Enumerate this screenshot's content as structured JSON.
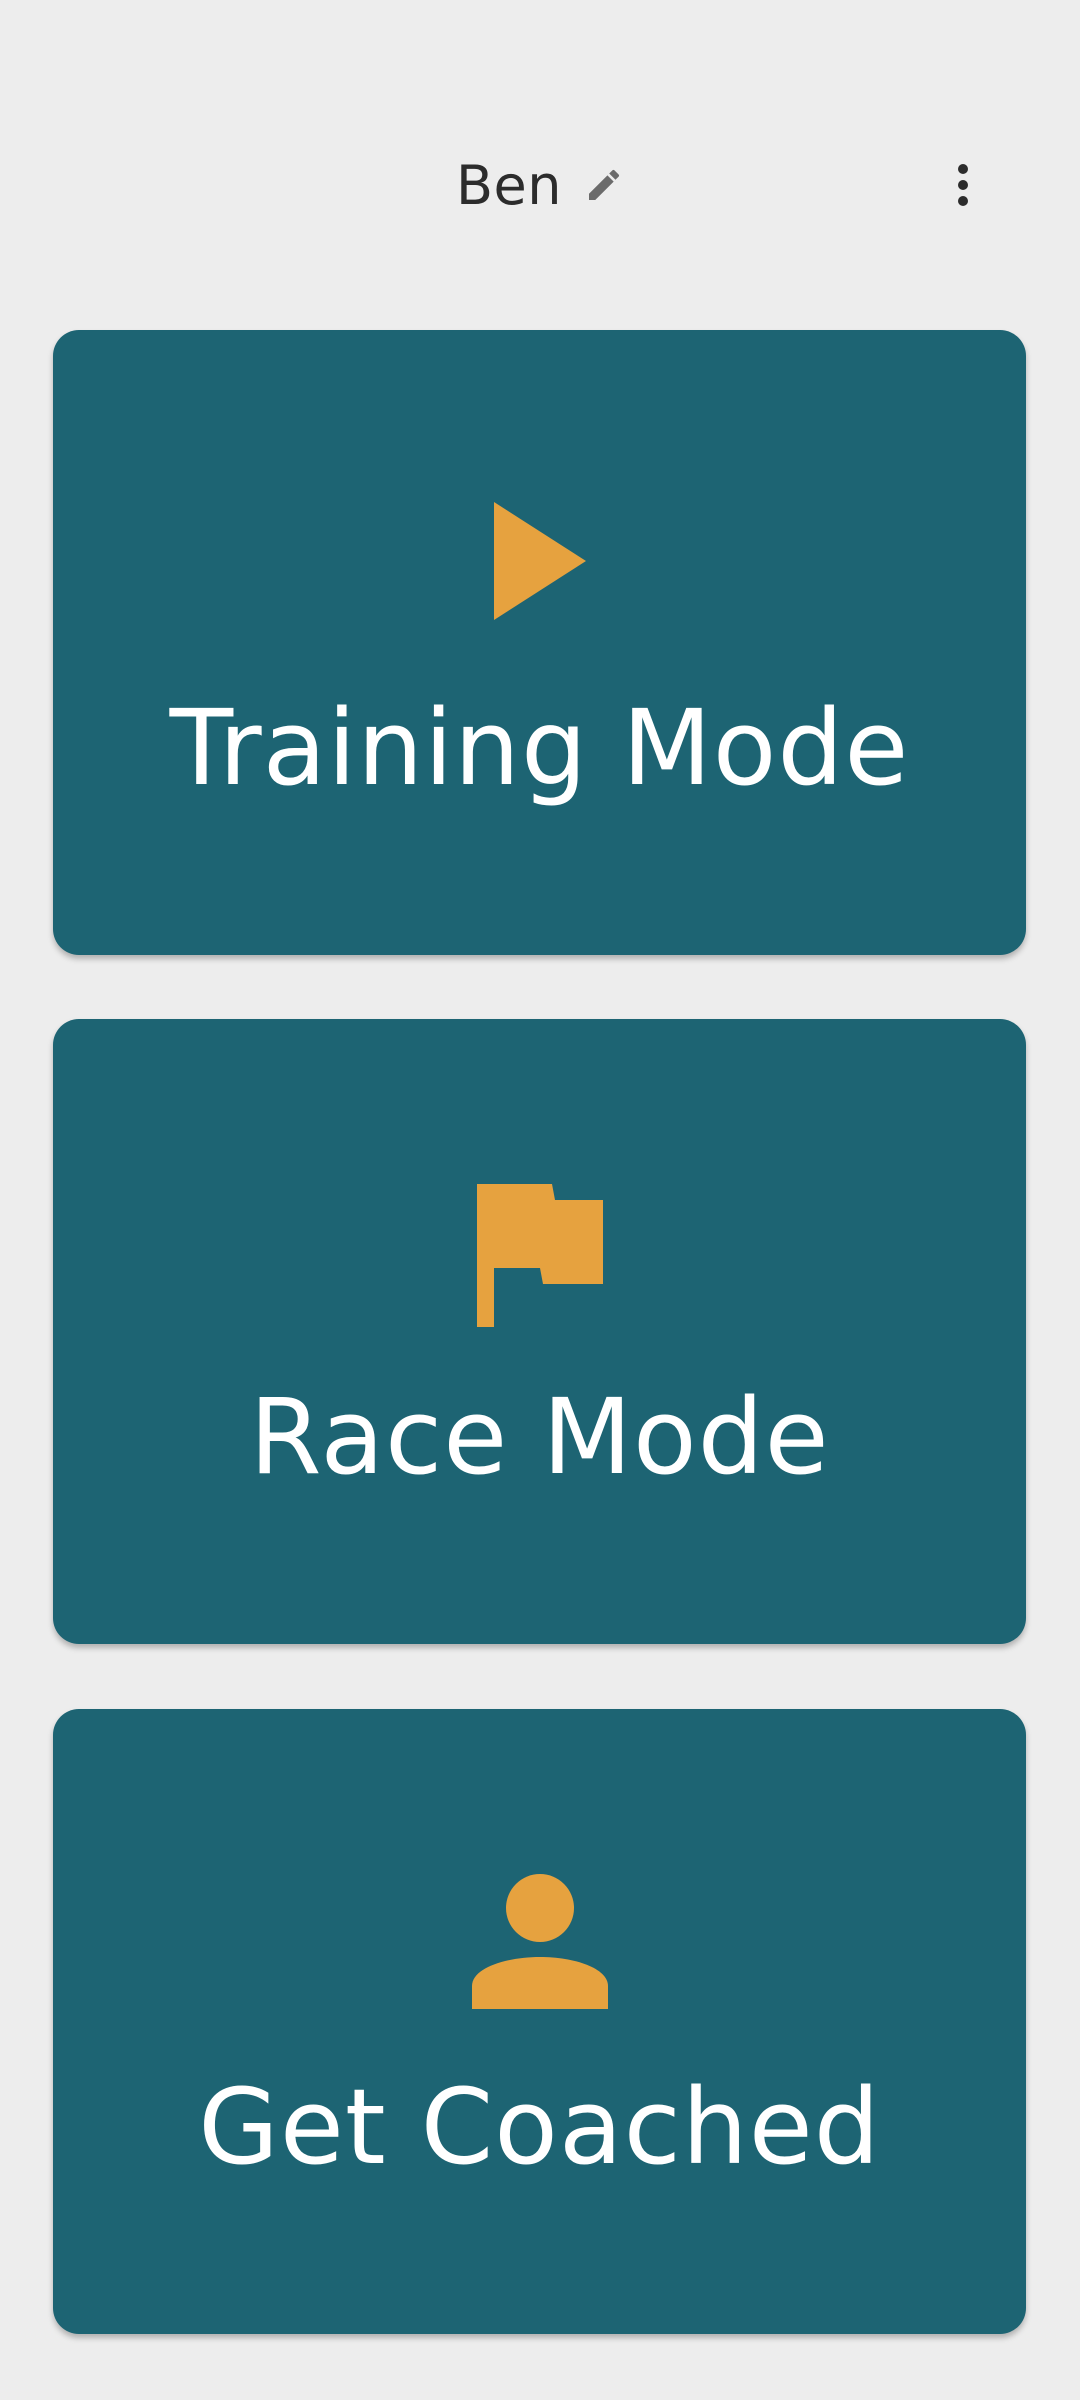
{
  "header": {
    "user_name": "Ben",
    "edit_icon": "edit-pencil-icon",
    "more_icon": "more-vertical-icon"
  },
  "modes": [
    {
      "label": "Training Mode",
      "icon": "play-icon"
    },
    {
      "label": "Race Mode",
      "icon": "flag-icon"
    },
    {
      "label": "Get Coached",
      "icon": "person-icon"
    }
  ],
  "colors": {
    "background": "#ededed",
    "card": "#1d6473",
    "accent": "#e6a23f",
    "card_text": "#ffffff",
    "header_text": "#2c2c2c"
  }
}
